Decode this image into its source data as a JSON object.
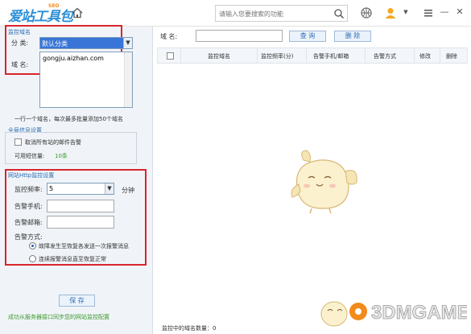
{
  "app": {
    "logo_text": "爱站工具包",
    "logo_badge": "SEO"
  },
  "titlebar": {
    "search_placeholder": "请输入您要搜索的功能",
    "icons": [
      "home-icon",
      "search-icon",
      "basketball-icon",
      "user-icon",
      "chevron-down-icon",
      "menu-icon",
      "minimize-icon",
      "close-icon"
    ],
    "minimize_glyph": "—",
    "close_glyph": "✕"
  },
  "left": {
    "domain_section": {
      "title": "监控域名",
      "category_label": "分 类:",
      "category_value": "默认分类",
      "domain_label": "域 名:",
      "domain_value": "gongju.aizhan.com",
      "hint": "一行一个域名，每次最多批量添加50个域名"
    },
    "global_section": {
      "title": "全局信息设置",
      "cancel_all_label": "取消所有站的邮件告警",
      "cancel_all_checked": false,
      "sms_label": "可用短信量:",
      "sms_value": "10条"
    },
    "http_section": {
      "title": "网站Http监控设置",
      "freq_label": "监控频率:",
      "freq_value": "5",
      "freq_unit": "分钟",
      "phone_label": "告警手机:",
      "phone_value": "",
      "email_label": "告警邮箱:",
      "email_value": "",
      "method_label": "告警方式:",
      "options": [
        {
          "label": "故障发生至恢复各发送一次报警消息",
          "selected": true
        },
        {
          "label": "连续报警消息直至恢复正常",
          "selected": false
        }
      ]
    },
    "save_label": "保 存",
    "sync_link": "成功从服务器接口同步您的网站监控配置"
  },
  "right": {
    "domain_filter_label": "域 名:",
    "domain_filter_value": "",
    "query_label": "查 询",
    "delete_label": "删 除",
    "columns": [
      "监控域名",
      "监控频率(分)",
      "告警手机/邮箱",
      "告警方式",
      "修改",
      "删除"
    ],
    "status": "监控中的域名数量：0"
  },
  "watermark": {
    "text": "3DMGAME"
  },
  "colors": {
    "accent": "#2b6bb2",
    "highlight_red": "#d9242b",
    "green": "#3c9a2c",
    "logo_blue": "#2a8fd8"
  }
}
